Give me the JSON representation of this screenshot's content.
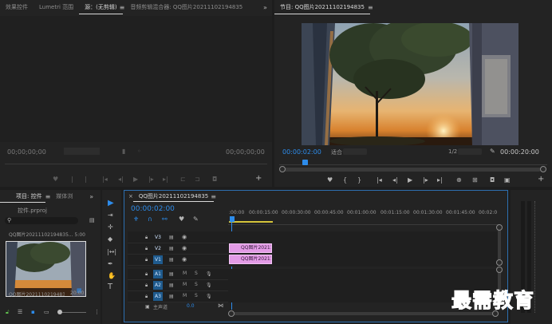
{
  "source_panel": {
    "tabs": [
      "效果控件",
      "Lumetri 范围",
      "源：(无剪辑)",
      "音频剪辑混合器: QQ图片20211102194835"
    ],
    "active_tab": 2,
    "timecode_left": "00;00;00;00",
    "timecode_right": "00;00;00;00",
    "menu_icon": "double-chevron-right-icon"
  },
  "program_panel": {
    "title": "节目: QQ图片20211102194835",
    "menu_icon": "hamburger-icon",
    "timecode_left": "00:00:02:00",
    "fit_label": "适合",
    "quality_label": "1/2",
    "timecode_right": "00:00:20:00"
  },
  "project_panel": {
    "tabs": [
      "项目: 控件",
      "媒体浏"
    ],
    "project_file": "控件.prproj",
    "search_placeholder": "",
    "thumb_title": "QQ图片20211102194835... 5:00",
    "thumb_label": "QQ图片20211102194835",
    "thumb_duration": "20:00"
  },
  "timeline": {
    "sequence_tab": "QQ图片20211102194835",
    "timecode": "00:00:02:00",
    "ruler": [
      ":00:00",
      "00:00:15:00",
      "00:00:30:00",
      "00:00:45:00",
      "00:01:00:00",
      "00:01:15:00",
      "00:01:30:00",
      "00:01:45:00",
      "00:02:0"
    ],
    "video_tracks": [
      "V3",
      "V2",
      "V1"
    ],
    "audio_tracks": [
      "A1",
      "A2",
      "A3"
    ],
    "audio_flags": {
      "m": "M",
      "s": "S"
    },
    "master_label": "主声道",
    "master_value": "0.0",
    "clip_v2": "QQ图片202111",
    "clip_v1": "QQ图片20211"
  },
  "watermark": "最需教育",
  "colors": {
    "accent": "#2d8ceb",
    "clip": "#e39be6",
    "playhead": "#2d8ceb"
  }
}
